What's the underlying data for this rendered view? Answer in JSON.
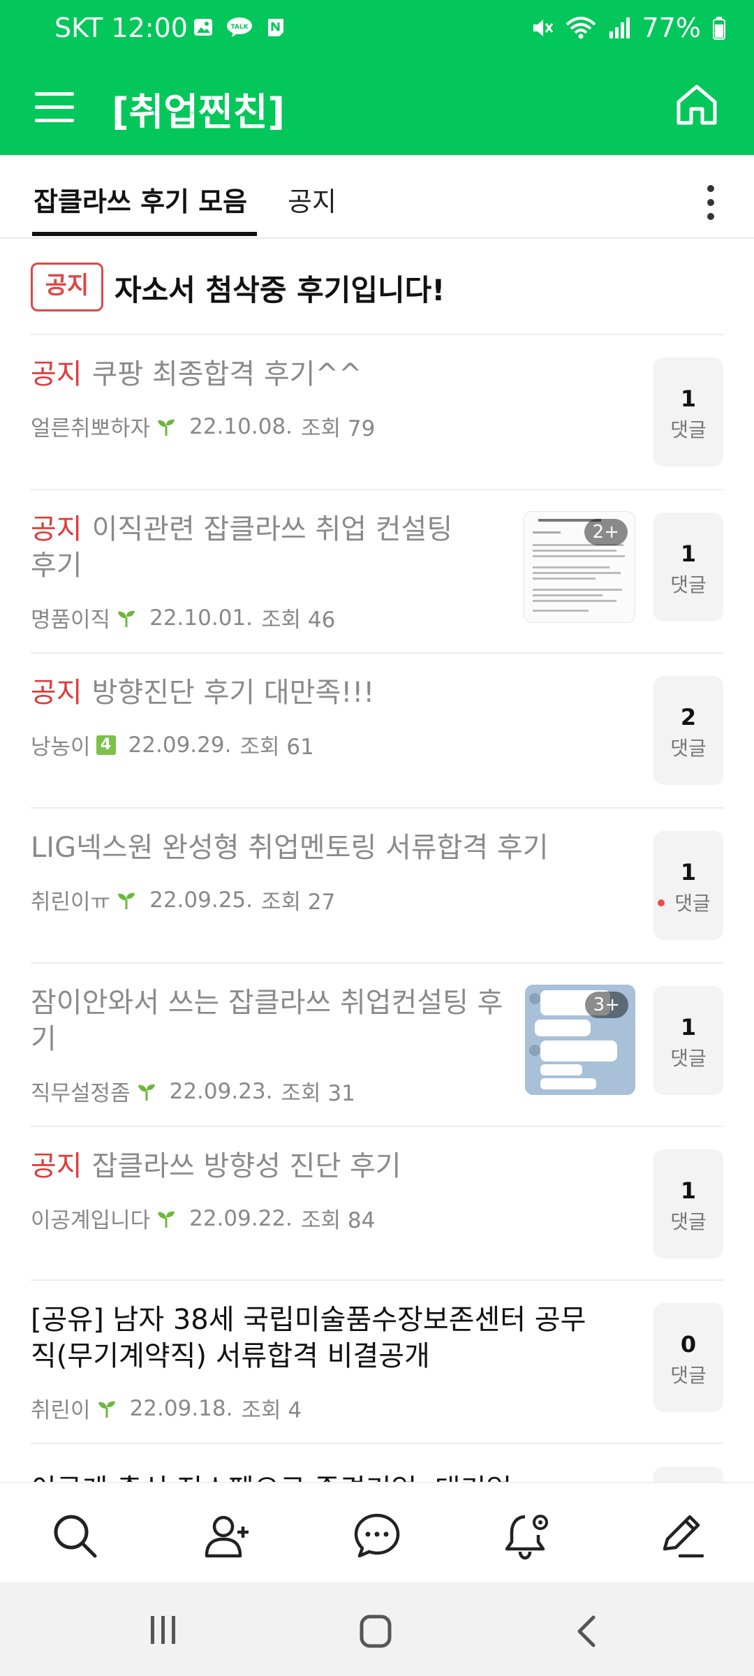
{
  "status_bar": {
    "carrier": "SKT",
    "time": "12:00",
    "battery": "77%",
    "left_icons": [
      "gallery-icon",
      "talk-icon",
      "n-icon"
    ],
    "right_icons": [
      "mute-icon",
      "wifi-icon",
      "signal-icon",
      "battery-icon"
    ]
  },
  "app_bar": {
    "title": "[취업찐친]",
    "background": "#03c75a"
  },
  "tabs": [
    {
      "label": "잡클라쓰 후기 모음",
      "active": true
    },
    {
      "label": "공지",
      "active": false
    }
  ],
  "notice": {
    "badge": "공지",
    "title": "자소서 첨삭중 후기입니다!"
  },
  "posts": [
    {
      "tag": "공지",
      "title": "쿠팡 최종합격 후기^^",
      "author": "얼른취뽀하자",
      "date": "22.10.08.",
      "views": "조회 79",
      "comments": "1",
      "comment_label": "댓글"
    },
    {
      "tag": "공지",
      "title": "이직관련 잡클라쓰 취업 컨설팅 후기",
      "author": "명품이직",
      "date": "22.10.01.",
      "views": "조회 46",
      "comments": "1",
      "comment_label": "댓글",
      "thumb_more": "2+"
    },
    {
      "tag": "공지",
      "title": "방향진단 후기 대만족!!!",
      "author": "낭농이",
      "level": "4",
      "date": "22.09.29.",
      "views": "조회 61",
      "comments": "2",
      "comment_label": "댓글"
    },
    {
      "tag": "",
      "title": "LIG넥스원 완성형 취업멘토링 서류합격 후기",
      "author": "취린이ㅠ",
      "date": "22.09.25.",
      "views": "조회 27",
      "comments": "1",
      "comment_label": "댓글",
      "unread": true
    },
    {
      "tag": "",
      "title": "잠이안와서 쓰는 잡클라쓰 취업컨설팅 후기",
      "author": "직무설정좀",
      "date": "22.09.23.",
      "views": "조회 31",
      "comments": "1",
      "comment_label": "댓글",
      "thumb_more": "3+"
    },
    {
      "tag": "공지",
      "title": "잡클라쓰 방향성 진단 후기",
      "author": "이공계입니다",
      "date": "22.09.22.",
      "views": "조회 84",
      "comments": "1",
      "comment_label": "댓글"
    },
    {
      "tag": "",
      "title": "[공유] 남자 38세 국립미술품수장보존센터 공무직(무기계약직) 서류합격 비결공개",
      "author": "취린이",
      "date": "22.09.18.",
      "views": "조회 4",
      "comments": "0",
      "comment_label": "댓글"
    }
  ],
  "partial_post_title": "이공계 출신 전스펙으로 중견기업, 대기업",
  "bottom_nav": [
    "search-icon",
    "add-friend-icon",
    "chat-icon",
    "notification-settings-icon",
    "write-icon"
  ],
  "colors": {
    "brand_green": "#03c75a",
    "notice_red": "#e03a3a"
  }
}
